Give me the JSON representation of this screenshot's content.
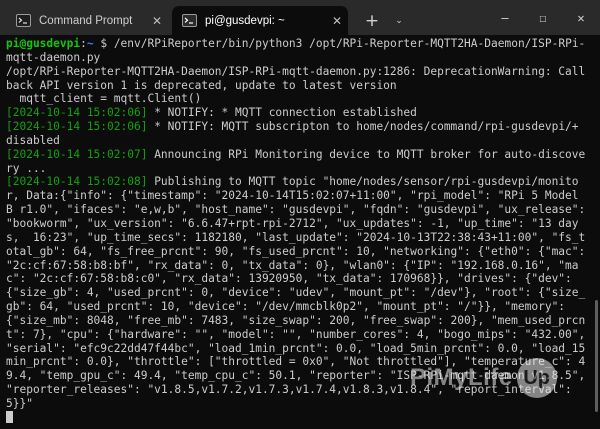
{
  "tabs": [
    {
      "label": "Command Prompt",
      "close": "✕"
    },
    {
      "label": "pi@gusdevpi: ~",
      "close": "✕"
    }
  ],
  "new_tab": "+",
  "tab_dropdown": "⌄",
  "window_controls": {
    "minimize": "—",
    "maximize": "☐",
    "close": "✕"
  },
  "colors": {
    "background": "#0c0c0c",
    "prompt_user": "#16c60c",
    "prompt_path": "#3b78ff",
    "timestamp": "#13a10e"
  },
  "terminal": {
    "prompt_user": "pi@gusdevpi",
    "prompt_sep": ":",
    "prompt_path": "~",
    "prompt_sym": " $ ",
    "command": "/env/RPiReporter/bin/python3 /opt/RPi-Reporter-MQTT2HA-Daemon/ISP-RPi-mqtt-daemon.py",
    "warning": "/opt/RPi-Reporter-MQTT2HA-Daemon/ISP-RPi-mqtt-daemon.py:1286: DeprecationWarning: Callback API version 1 is deprecated, update to latest version\n  mqtt_client = mqtt.Client()",
    "ts1": "[2024-10-14 15:02:06]",
    "msg1": " * NOTIFY: * MQTT connection established",
    "ts2": "[2024-10-14 15:02:06]",
    "msg2": " * NOTIFY: MQTT subscripton to home/nodes/command/rpi-gusdevpi/+ disabled",
    "ts3": "[2024-10-14 15:02:07]",
    "msg3": " Announcing RPi Monitoring device to MQTT broker for auto-discovery ...",
    "ts4": "[2024-10-14 15:02:08]",
    "msg4": " Publishing to MQTT topic \"home/nodes/sensor/rpi-gusdevpi/monitor, Data:{\"info\": {\"timestamp\": \"2024-10-14T15:02:07+11:00\", \"rpi_model\": \"RPi 5 Model B r1.0\", \"ifaces\": \"e,w,b\", \"host_name\": \"gusdevpi\", \"fqdn\": \"gusdevpi\", \"ux_release\": \"bookworm\", \"ux_version\": \"6.6.47+rpt-rpi-2712\", \"ux_updates\": -1, \"up_time\": \"13 days,  16:23\", \"up_time_secs\": 1182180, \"last_update\": \"2024-10-13T22:38:43+11:00\", \"fs_total_gb\": 64, \"fs_free_prcnt\": 90, \"fs_used_prcnt\": 10, \"networking\": {\"eth0\": {\"mac\": \"2c:cf:67:58:b8:bf\", \"rx_data\": 0, \"tx_data\": 0}, \"wlan0\": {\"IP\": \"192.168.0.16\", \"mac\": \"2c:cf:67:58:b8:c0\", \"rx_data\": 13920950, \"tx_data\": 170968}}, \"drives\": {\"dev\": {\"size_gb\": 4, \"used_prcnt\": 0, \"device\": \"udev\", \"mount_pt\": \"/dev\"}, \"root\": {\"size_gb\": 64, \"used_prcnt\": 10, \"device\": \"/dev/mmcblk0p2\", \"mount_pt\": \"/\"}}, \"memory\": {\"size_mb\": 8048, \"free_mb\": 7483, \"size_swap\": 200, \"free_swap\": 200}, \"mem_used_prcnt\": 7}, \"cpu\": {\"hardware\": \"\", \"model\": \"\", \"number_cores\": 4, \"bogo_mips\": \"432.00\", \"serial\": \"efc9c22dd47f44bc\", \"load_1min_prcnt\": 0.0, \"load_5min_prcnt\": 0.0, \"load_15min_prcnt\": 0.0}, \"throttle\": [\"throttled = 0x0\", \"Not throttled\"], \"temperature_c\": 49.4, \"temp_gpu_c\": 49.4, \"temp_cpu_c\": 50.1, \"reporter\": \"ISP-RPi-mqtt-daemon v1.8.5\", \"reporter_releases\": \"v1.8.5,v1.7.2,v1.7.3,v1.7.4,v1.8.3,v1.8.4\", \"report_interval\": 5}}\""
  },
  "watermark": {
    "text": "PiMyLife",
    "badge": "Up"
  }
}
